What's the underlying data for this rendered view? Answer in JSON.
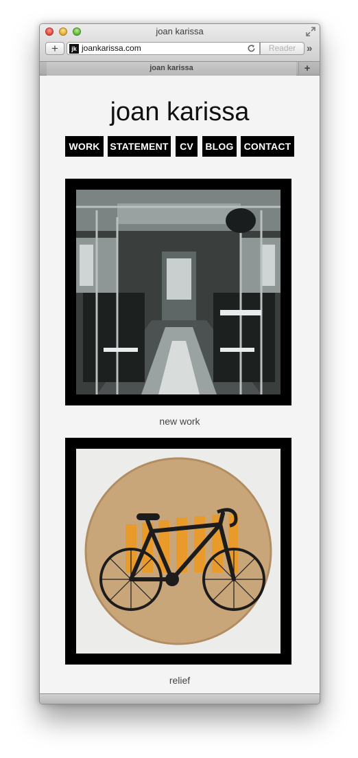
{
  "browser": {
    "window_title": "joan karissa",
    "url": "joankarissa.com",
    "favicon_text": "jk",
    "reader_label": "Reader",
    "tab_label": "joan karissa"
  },
  "site": {
    "title": "joan karissa",
    "nav": [
      "WORK",
      "STATEMENT",
      "CV",
      "BLOG",
      "CONTACT"
    ]
  },
  "gallery": [
    {
      "caption": "new work",
      "image": "bus-interior-print"
    },
    {
      "caption": "relief",
      "image": "bicycle-relief-print"
    }
  ],
  "colors": {
    "nav_bg": "#000000",
    "nav_text": "#ffffff",
    "page_bg": "#f4f4f4",
    "frame": "#000000",
    "bike_orange": "#e89a2a"
  }
}
